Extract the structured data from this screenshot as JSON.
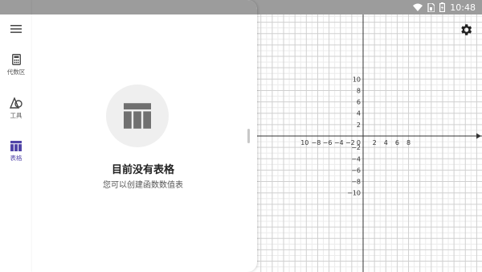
{
  "status_bar": {
    "time": "10:48",
    "icons": [
      "wifi-icon",
      "sim-icon",
      "battery-icon"
    ]
  },
  "rail": {
    "menu_icon": "menu-icon",
    "items": [
      {
        "label": "代数区",
        "icon": "calculator-icon",
        "active": false
      },
      {
        "label": "工具",
        "icon": "shapes-icon",
        "active": false
      },
      {
        "label": "表格",
        "icon": "table-icon",
        "active": true
      }
    ]
  },
  "empty_state": {
    "icon": "table-icon",
    "title": "目前没有表格",
    "subtitle": "您可以创建函数数值表"
  },
  "graph": {
    "x_range": [
      -10,
      10
    ],
    "y_range": [
      -10,
      10
    ],
    "x_ticks": [
      "10",
      "−8",
      "−6",
      "−4",
      "−2",
      "0",
      "2",
      "4",
      "6",
      "8"
    ],
    "y_ticks": [
      "10",
      "8",
      "6",
      "4",
      "2",
      "−2",
      "−4",
      "−6",
      "−8",
      "−10"
    ],
    "grid": true,
    "settings_icon": "gear-icon"
  },
  "colors": {
    "accent": "#5145a8",
    "statusbar": "#9c9c9c"
  }
}
